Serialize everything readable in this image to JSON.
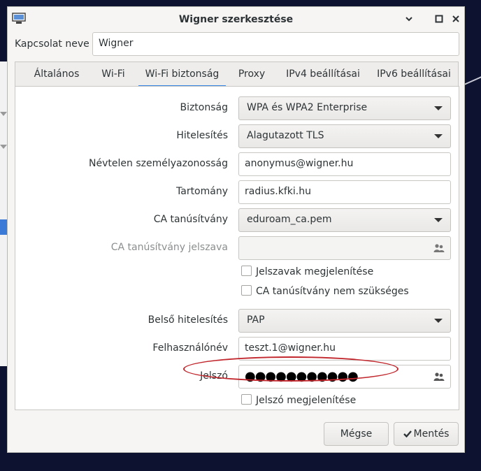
{
  "window": {
    "title": "Wigner szerkesztése"
  },
  "connection": {
    "name_label": "Kapcsolat neve",
    "name_value": "Wigner"
  },
  "tabs": [
    {
      "label": "Általános",
      "active": false
    },
    {
      "label": "Wi-Fi",
      "active": false
    },
    {
      "label": "Wi-Fi biztonság",
      "active": true
    },
    {
      "label": "Proxy",
      "active": false
    },
    {
      "label": "IPv4 beállításai",
      "active": false
    },
    {
      "label": "IPv6 beállításai",
      "active": false
    }
  ],
  "security": {
    "security_label": "Biztonság",
    "security_value": "WPA és WPA2 Enterprise",
    "auth_label": "Hitelesítés",
    "auth_value": "Alagutazott TLS",
    "anon_label": "Névtelen személyazonosság",
    "anon_value": "anonymus@wigner.hu",
    "domain_label": "Tartomány",
    "domain_value": "radius.kfki.hu",
    "ca_label": "CA tanúsítvány",
    "ca_value": "eduroam_ca.pem",
    "ca_pwd_label": "CA tanúsítvány jelszava",
    "ca_pwd_value": "",
    "show_passwords_label": "Jelszavak megjelenítése",
    "ca_not_required_label": "CA tanúsítvány nem szükséges",
    "inner_auth_label": "Belső hitelesítés",
    "inner_auth_value": "PAP",
    "username_label": "Felhasználónév",
    "username_value": "teszt.1@wigner.hu",
    "password_label": "Jelszó",
    "password_value": "●●●●●●●●●●●",
    "show_password_label": "Jelszó megjelenítése"
  },
  "buttons": {
    "cancel": "Mégse",
    "save": "Mentés"
  },
  "icons": {
    "app": "network-icon",
    "window_controls": [
      "chevron-down-icon",
      "maximize-icon",
      "close-icon"
    ],
    "password_store": "person-icon"
  },
  "colors": {
    "accent": "#3584e4",
    "highlight_ellipse": "#c1272d"
  }
}
